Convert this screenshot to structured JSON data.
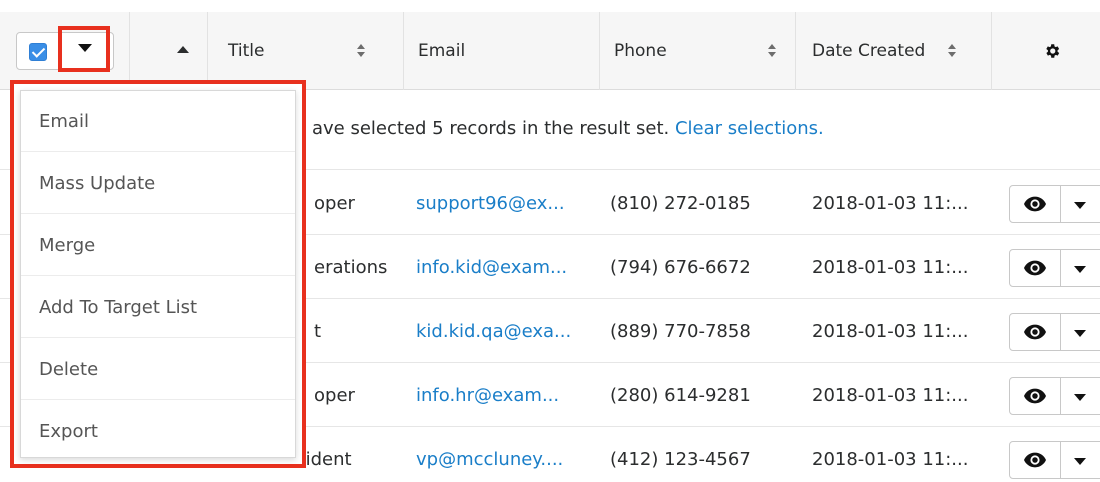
{
  "page": {
    "heading": ""
  },
  "header": {
    "columns": [
      {
        "key": "title",
        "label": "Title"
      },
      {
        "key": "email",
        "label": "Email"
      },
      {
        "key": "phone",
        "label": "Phone"
      },
      {
        "key": "date_created",
        "label": "Date Created"
      }
    ]
  },
  "banner": {
    "text": "ave selected 5 records in the result set.",
    "link": "Clear selections."
  },
  "mass_actions_menu": {
    "items": [
      "Email",
      "Mass Update",
      "Merge",
      "Add To Target List",
      "Delete",
      "Export"
    ]
  },
  "rows": [
    {
      "title_fragment": "oper",
      "email": "support96@ex...",
      "phone": "(810) 272-0185",
      "date": "2018-01-03 11:..."
    },
    {
      "title_fragment": "erations",
      "email": "info.kid@exam...",
      "phone": "(794) 676-6672",
      "date": "2018-01-03 11:..."
    },
    {
      "title_fragment": "t",
      "email": "kid.kid.qa@exa...",
      "phone": "(889) 770-7858",
      "date": "2018-01-03 11:..."
    },
    {
      "title_fragment": "oper",
      "email": "info.hr@exam...",
      "phone": "(280) 614-9281",
      "date": "2018-01-03 11:..."
    },
    {
      "title_fragment": "Vice President",
      "email": "vp@mccluney....",
      "phone": "(412) 123-4567",
      "date": "2018-01-03 11:..."
    }
  ],
  "colors": {
    "highlight": "#e8301e",
    "link": "#1a7ec8",
    "checkbox": "#3a8ee6"
  },
  "icons": [
    "checkbox-icon",
    "caret-down-icon",
    "sort-icon",
    "gear-icon",
    "eye-icon"
  ]
}
